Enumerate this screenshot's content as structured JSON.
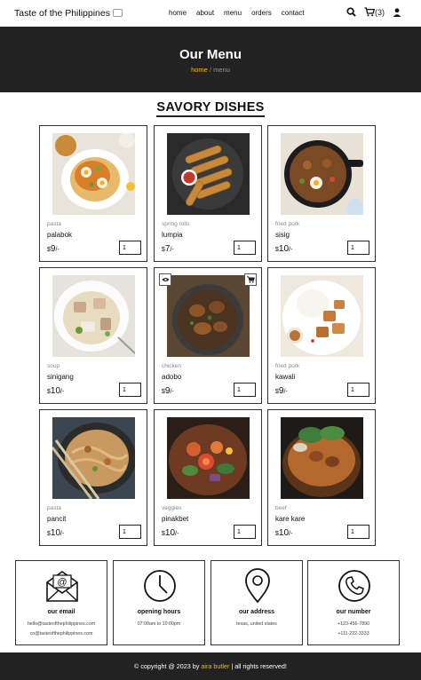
{
  "header": {
    "brand": "Taste of the Philippines",
    "brand_icon": "plate-icon",
    "nav": [
      "home",
      "about",
      "menu",
      "orders",
      "contact"
    ],
    "cart_count": "(3)",
    "icons": [
      "search-icon",
      "cart-icon",
      "user-icon"
    ]
  },
  "hero": {
    "title": "Our Menu",
    "crumb_home": "home",
    "crumb_sep": " / ",
    "crumb_current": "menu"
  },
  "section": {
    "title": "SAVORY DISHES"
  },
  "dishes": [
    {
      "category": "pasta",
      "name": "palabok",
      "currency": "$",
      "price": "9",
      "suffix": "/-",
      "qty": "1"
    },
    {
      "category": "spring rolls",
      "name": "lumpia",
      "currency": "$",
      "price": "7",
      "suffix": "/-",
      "qty": "1"
    },
    {
      "category": "fried pork",
      "name": "sisig",
      "currency": "$",
      "price": "10",
      "suffix": "/-",
      "qty": "1"
    },
    {
      "category": "soup",
      "name": "sinigang",
      "currency": "$",
      "price": "10",
      "suffix": "/-",
      "qty": "1"
    },
    {
      "category": "chicken",
      "name": "adobo",
      "currency": "$",
      "price": "9",
      "suffix": "/-",
      "qty": "1"
    },
    {
      "category": "fried pork",
      "name": "kawali",
      "currency": "$",
      "price": "9",
      "suffix": "/-",
      "qty": "1"
    },
    {
      "category": "pasta",
      "name": "pancit",
      "currency": "$",
      "price": "10",
      "suffix": "/-",
      "qty": "1"
    },
    {
      "category": "veggies",
      "name": "pinakbet",
      "currency": "$",
      "price": "10",
      "suffix": "/-",
      "qty": "1"
    },
    {
      "category": "beef",
      "name": "kare kare",
      "currency": "$",
      "price": "10",
      "suffix": "/-",
      "qty": "1"
    }
  ],
  "info": [
    {
      "icon": "email-icon",
      "title": "our email",
      "lines": [
        "hello@tasteofthephilippines.com",
        "co@tasteofthephilippines.com"
      ]
    },
    {
      "icon": "clock-icon",
      "title": "opening hours",
      "lines": [
        "07:00am to 10:00pm"
      ]
    },
    {
      "icon": "location-pin-icon",
      "title": "our address",
      "lines": [
        "texas, united states"
      ]
    },
    {
      "icon": "phone-icon",
      "title": "our number",
      "lines": [
        "+123-456-7890",
        "+111-222-3333"
      ]
    }
  ],
  "footer": {
    "prefix": "© copyright @ 2023 by ",
    "name": "aira butler",
    "suffix": " | all rights reserved!"
  },
  "colors": {
    "accent": "#f0b90b",
    "dark": "#222222"
  }
}
